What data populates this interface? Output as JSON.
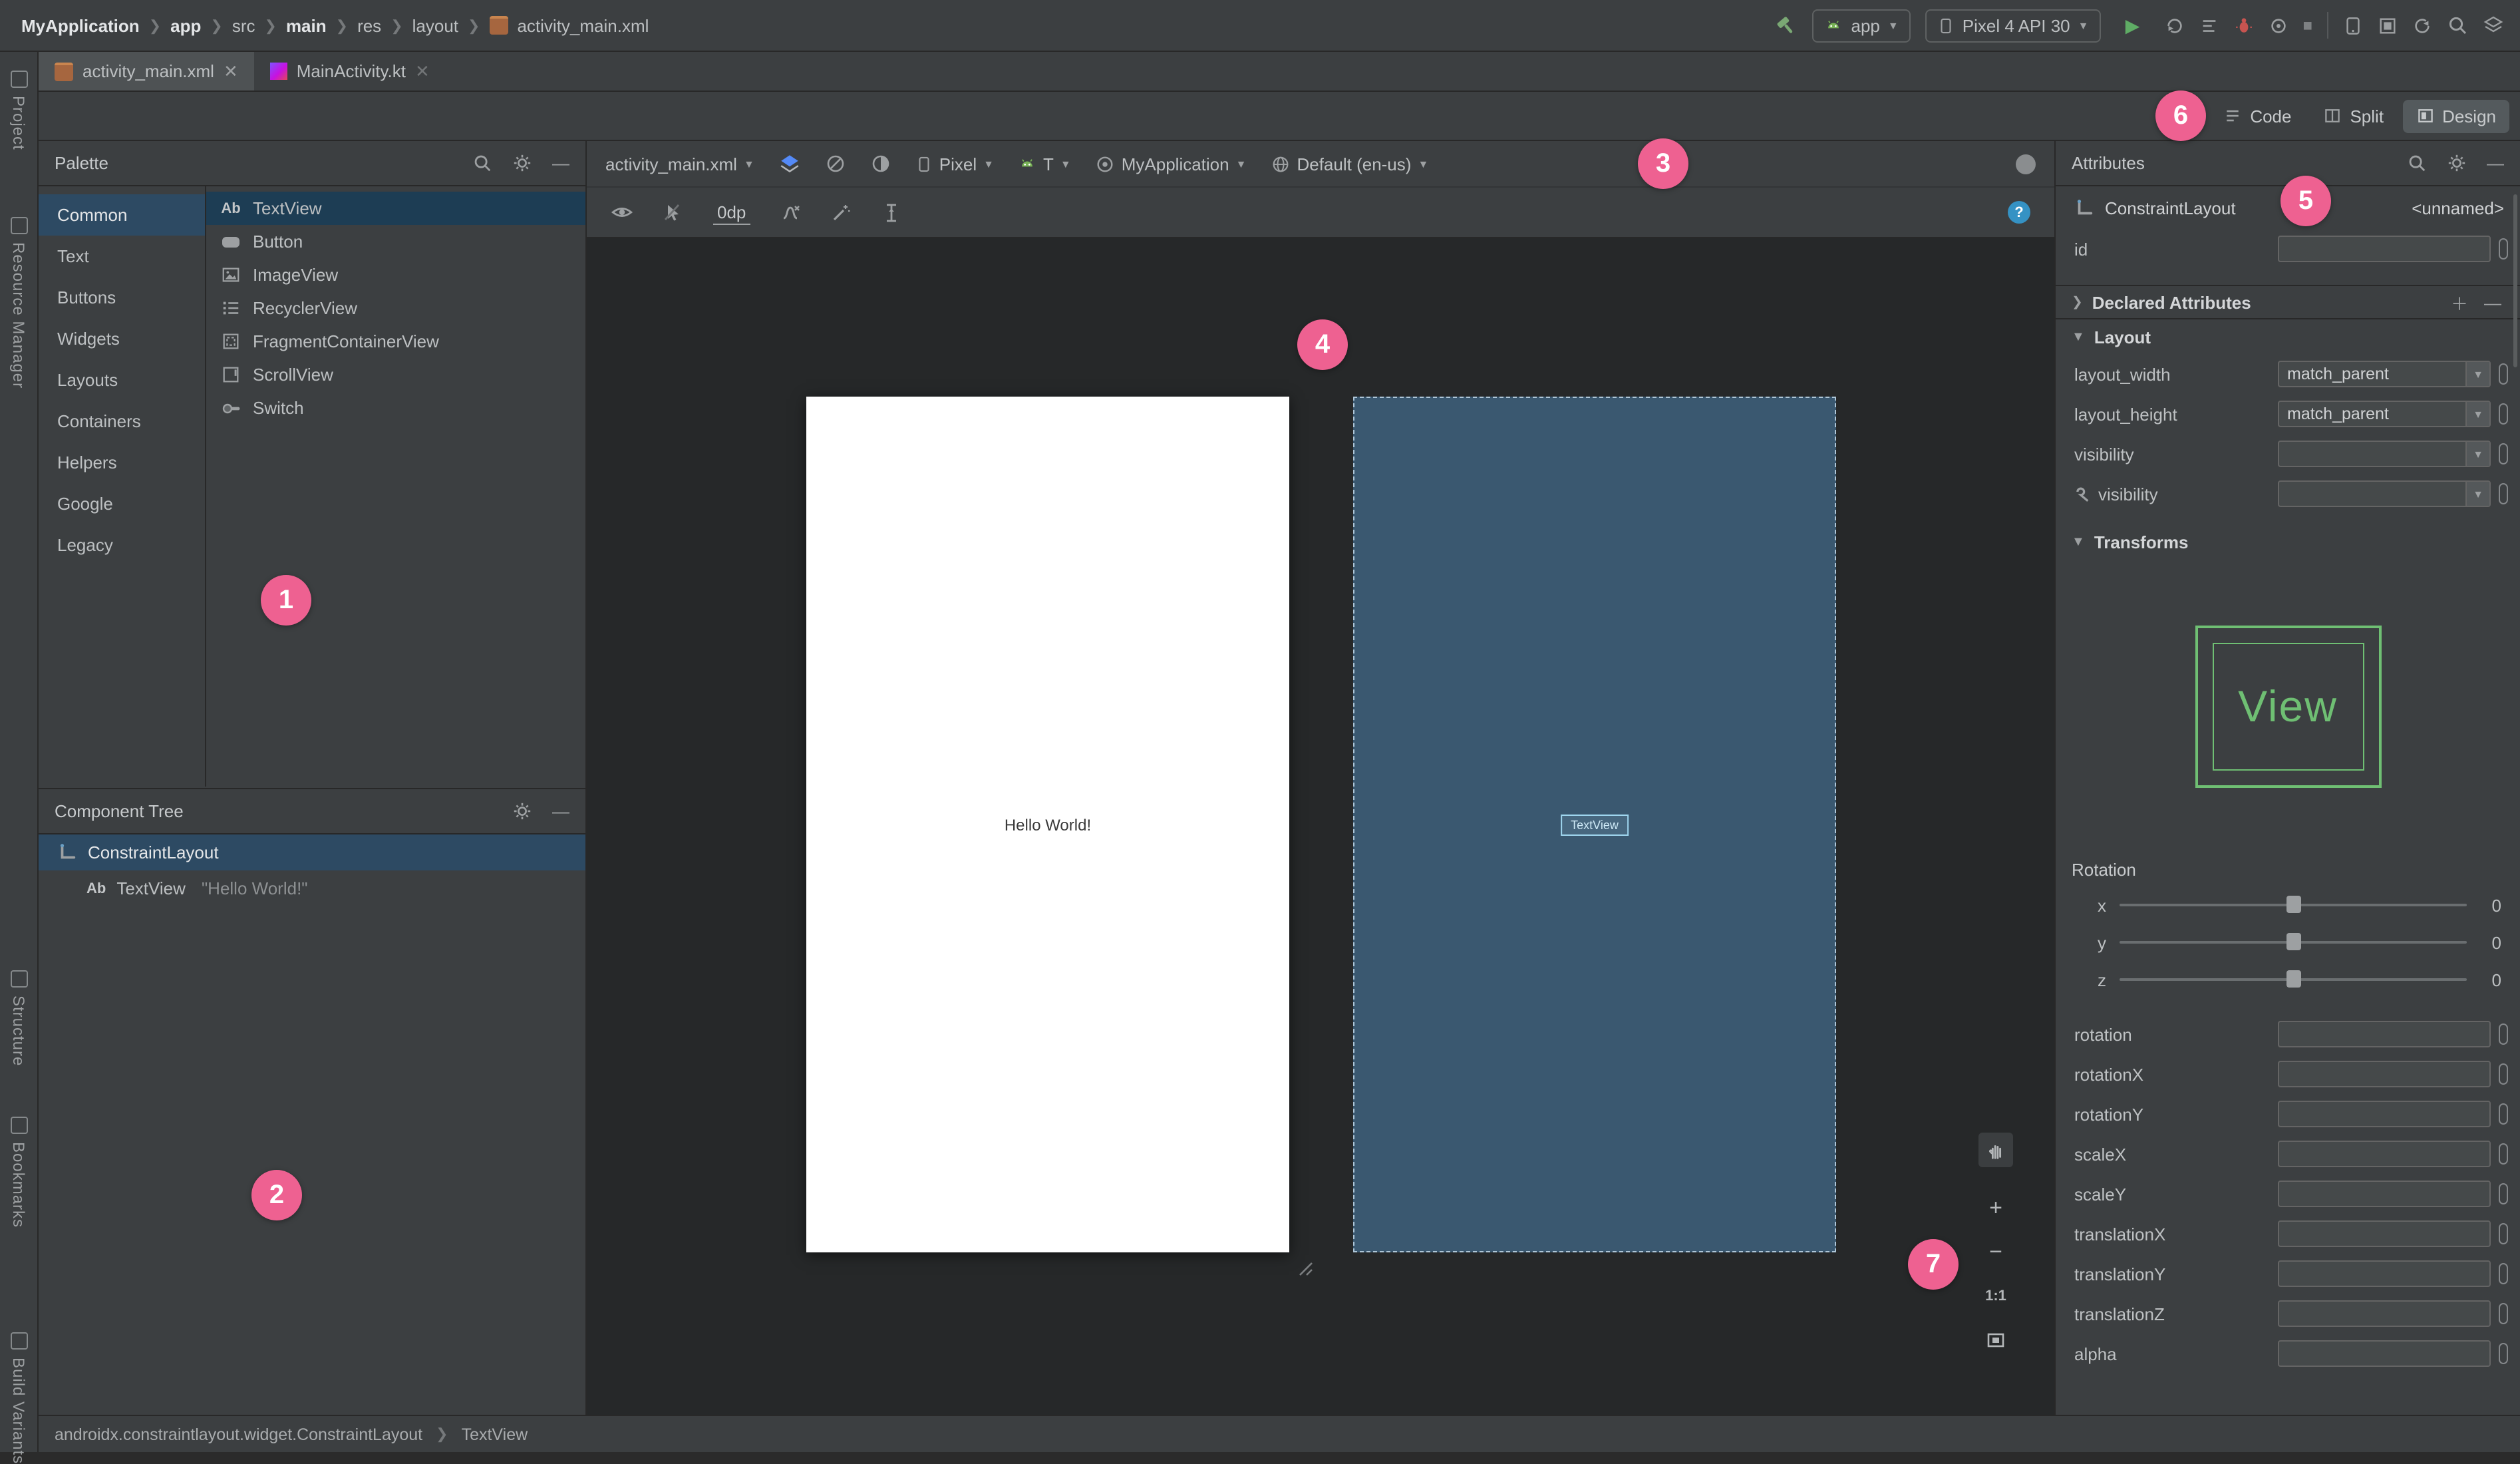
{
  "colors": {
    "badge_pink": "#ee6191",
    "selection_blue": "#2d4a63",
    "blueprint_blue": "#3a5870",
    "preview_green": "#6fbf73",
    "run_green": "#5fad65",
    "help_blue": "#3592c4"
  },
  "icons": {
    "search": "magnifier",
    "settings": "gear",
    "minimize": "horizontal-bar",
    "close": "x",
    "dropdown": "caret-down",
    "build": "hammer",
    "run": "green-play-triangle",
    "debug": "red-bug",
    "stop": "square",
    "visibility": "eye",
    "help": "blue-question-circle",
    "pan": "hand",
    "design-surface": "blue-layers",
    "orientation": "circle-slash",
    "night-mode": "half-circle",
    "device": "phone-outline",
    "api-version": "android-head",
    "theme": "ring",
    "locale": "globe",
    "wrench": "wrench"
  },
  "window": {
    "breadcrumb": [
      "MyApplication",
      "app",
      "src",
      "main",
      "res",
      "layout",
      "activity_main.xml"
    ],
    "run_config": "app",
    "device": "Pixel 4 API 30",
    "tabs": [
      {
        "label": "activity_main.xml"
      },
      {
        "label": "MainActivity.kt"
      }
    ]
  },
  "left_strip": {
    "items": [
      {
        "label": "Project"
      },
      {
        "label": "Resource Manager"
      },
      {
        "label": "Structure"
      },
      {
        "label": "Bookmarks"
      },
      {
        "label": "Build Variants"
      }
    ]
  },
  "view_modes": {
    "code": "Code",
    "split": "Split",
    "design": "Design",
    "selected": "Design"
  },
  "palette": {
    "title": "Palette",
    "categories": [
      {
        "label": "Common"
      },
      {
        "label": "Text"
      },
      {
        "label": "Buttons"
      },
      {
        "label": "Widgets"
      },
      {
        "label": "Layouts"
      },
      {
        "label": "Containers"
      },
      {
        "label": "Helpers"
      },
      {
        "label": "Google"
      },
      {
        "label": "Legacy"
      }
    ],
    "selected_category": "Common",
    "items": [
      {
        "label": "TextView"
      },
      {
        "label": "Button"
      },
      {
        "label": "ImageView"
      },
      {
        "label": "RecyclerView"
      },
      {
        "label": "FragmentContainerView"
      },
      {
        "label": "ScrollView"
      },
      {
        "label": "Switch"
      }
    ],
    "selected_item": "TextView"
  },
  "component_tree": {
    "title": "Component Tree",
    "root": "ConstraintLayout",
    "child": "TextView",
    "child_text": "\"Hello World!\""
  },
  "design_toolbar": {
    "file": "activity_main.xml",
    "device": "Pixel",
    "api": "T",
    "theme": "MyApplication",
    "locale": "Default (en-us)",
    "default_margin": "0dp"
  },
  "canvas": {
    "design_text": "Hello World!",
    "blueprint_text": "TextView"
  },
  "zoom_controls": {
    "zoom_in": "+",
    "zoom_out": "−",
    "ratio": "1:1"
  },
  "attributes": {
    "title": "Attributes",
    "component": "ConstraintLayout",
    "component_id": "<unnamed>",
    "id_label": "id",
    "id_value": "",
    "declared_section": "Declared Attributes",
    "layout_section": "Layout",
    "layout_rows": [
      {
        "label": "layout_width",
        "value": "match_parent"
      },
      {
        "label": "layout_height",
        "value": "match_parent"
      },
      {
        "label": "visibility",
        "value": ""
      },
      {
        "label": "visibility",
        "value": ""
      }
    ],
    "transforms_section": "Transforms",
    "view_preview": "View",
    "rotation_title": "Rotation",
    "sliders": [
      {
        "axis": "x",
        "value": "0"
      },
      {
        "axis": "y",
        "value": "0"
      },
      {
        "axis": "z",
        "value": "0"
      }
    ],
    "fields": [
      {
        "label": "rotation",
        "value": ""
      },
      {
        "label": "rotationX",
        "value": ""
      },
      {
        "label": "rotationY",
        "value": ""
      },
      {
        "label": "scaleX",
        "value": ""
      },
      {
        "label": "scaleY",
        "value": ""
      },
      {
        "label": "translationX",
        "value": ""
      },
      {
        "label": "translationY",
        "value": ""
      },
      {
        "label": "translationZ",
        "value": ""
      },
      {
        "label": "alpha",
        "value": ""
      }
    ]
  },
  "status_bar": {
    "class_path": "androidx.constraintlayout.widget.ConstraintLayout",
    "selected": "TextView"
  },
  "annotations": {
    "labels": [
      "1",
      "2",
      "3",
      "4",
      "5",
      "6",
      "7"
    ]
  }
}
